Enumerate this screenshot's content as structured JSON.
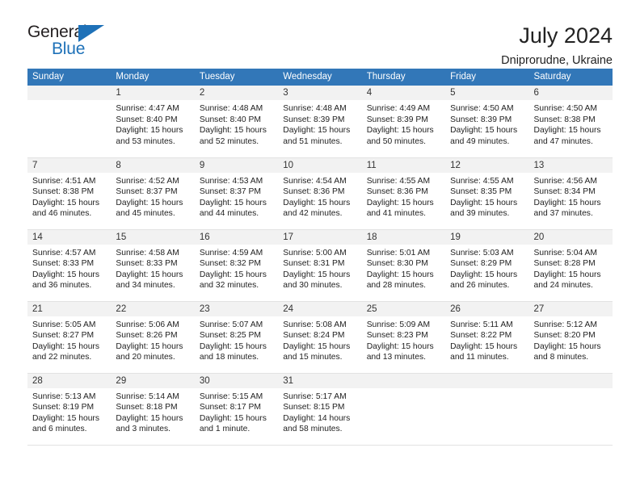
{
  "logo": {
    "text_general": "General",
    "text_blue": "Blue",
    "triangle_color": "#1e71b8"
  },
  "header": {
    "month_title": "July 2024",
    "location": "Dniprorudne, Ukraine"
  },
  "theme": {
    "header_bg": "#3277b8",
    "daynum_band_bg": "#f2f2f2",
    "grid_line": "#e2e2e2"
  },
  "calendar": {
    "weekday_headers": [
      "Sunday",
      "Monday",
      "Tuesday",
      "Wednesday",
      "Thursday",
      "Friday",
      "Saturday"
    ],
    "weeks": [
      [
        {
          "day": "",
          "sunrise": "",
          "sunset": "",
          "daylight_line1": "",
          "daylight_line2": ""
        },
        {
          "day": "1",
          "sunrise": "Sunrise: 4:47 AM",
          "sunset": "Sunset: 8:40 PM",
          "daylight_line1": "Daylight: 15 hours",
          "daylight_line2": "and 53 minutes."
        },
        {
          "day": "2",
          "sunrise": "Sunrise: 4:48 AM",
          "sunset": "Sunset: 8:40 PM",
          "daylight_line1": "Daylight: 15 hours",
          "daylight_line2": "and 52 minutes."
        },
        {
          "day": "3",
          "sunrise": "Sunrise: 4:48 AM",
          "sunset": "Sunset: 8:39 PM",
          "daylight_line1": "Daylight: 15 hours",
          "daylight_line2": "and 51 minutes."
        },
        {
          "day": "4",
          "sunrise": "Sunrise: 4:49 AM",
          "sunset": "Sunset: 8:39 PM",
          "daylight_line1": "Daylight: 15 hours",
          "daylight_line2": "and 50 minutes."
        },
        {
          "day": "5",
          "sunrise": "Sunrise: 4:50 AM",
          "sunset": "Sunset: 8:39 PM",
          "daylight_line1": "Daylight: 15 hours",
          "daylight_line2": "and 49 minutes."
        },
        {
          "day": "6",
          "sunrise": "Sunrise: 4:50 AM",
          "sunset": "Sunset: 8:38 PM",
          "daylight_line1": "Daylight: 15 hours",
          "daylight_line2": "and 47 minutes."
        }
      ],
      [
        {
          "day": "7",
          "sunrise": "Sunrise: 4:51 AM",
          "sunset": "Sunset: 8:38 PM",
          "daylight_line1": "Daylight: 15 hours",
          "daylight_line2": "and 46 minutes."
        },
        {
          "day": "8",
          "sunrise": "Sunrise: 4:52 AM",
          "sunset": "Sunset: 8:37 PM",
          "daylight_line1": "Daylight: 15 hours",
          "daylight_line2": "and 45 minutes."
        },
        {
          "day": "9",
          "sunrise": "Sunrise: 4:53 AM",
          "sunset": "Sunset: 8:37 PM",
          "daylight_line1": "Daylight: 15 hours",
          "daylight_line2": "and 44 minutes."
        },
        {
          "day": "10",
          "sunrise": "Sunrise: 4:54 AM",
          "sunset": "Sunset: 8:36 PM",
          "daylight_line1": "Daylight: 15 hours",
          "daylight_line2": "and 42 minutes."
        },
        {
          "day": "11",
          "sunrise": "Sunrise: 4:55 AM",
          "sunset": "Sunset: 8:36 PM",
          "daylight_line1": "Daylight: 15 hours",
          "daylight_line2": "and 41 minutes."
        },
        {
          "day": "12",
          "sunrise": "Sunrise: 4:55 AM",
          "sunset": "Sunset: 8:35 PM",
          "daylight_line1": "Daylight: 15 hours",
          "daylight_line2": "and 39 minutes."
        },
        {
          "day": "13",
          "sunrise": "Sunrise: 4:56 AM",
          "sunset": "Sunset: 8:34 PM",
          "daylight_line1": "Daylight: 15 hours",
          "daylight_line2": "and 37 minutes."
        }
      ],
      [
        {
          "day": "14",
          "sunrise": "Sunrise: 4:57 AM",
          "sunset": "Sunset: 8:33 PM",
          "daylight_line1": "Daylight: 15 hours",
          "daylight_line2": "and 36 minutes."
        },
        {
          "day": "15",
          "sunrise": "Sunrise: 4:58 AM",
          "sunset": "Sunset: 8:33 PM",
          "daylight_line1": "Daylight: 15 hours",
          "daylight_line2": "and 34 minutes."
        },
        {
          "day": "16",
          "sunrise": "Sunrise: 4:59 AM",
          "sunset": "Sunset: 8:32 PM",
          "daylight_line1": "Daylight: 15 hours",
          "daylight_line2": "and 32 minutes."
        },
        {
          "day": "17",
          "sunrise": "Sunrise: 5:00 AM",
          "sunset": "Sunset: 8:31 PM",
          "daylight_line1": "Daylight: 15 hours",
          "daylight_line2": "and 30 minutes."
        },
        {
          "day": "18",
          "sunrise": "Sunrise: 5:01 AM",
          "sunset": "Sunset: 8:30 PM",
          "daylight_line1": "Daylight: 15 hours",
          "daylight_line2": "and 28 minutes."
        },
        {
          "day": "19",
          "sunrise": "Sunrise: 5:03 AM",
          "sunset": "Sunset: 8:29 PM",
          "daylight_line1": "Daylight: 15 hours",
          "daylight_line2": "and 26 minutes."
        },
        {
          "day": "20",
          "sunrise": "Sunrise: 5:04 AM",
          "sunset": "Sunset: 8:28 PM",
          "daylight_line1": "Daylight: 15 hours",
          "daylight_line2": "and 24 minutes."
        }
      ],
      [
        {
          "day": "21",
          "sunrise": "Sunrise: 5:05 AM",
          "sunset": "Sunset: 8:27 PM",
          "daylight_line1": "Daylight: 15 hours",
          "daylight_line2": "and 22 minutes."
        },
        {
          "day": "22",
          "sunrise": "Sunrise: 5:06 AM",
          "sunset": "Sunset: 8:26 PM",
          "daylight_line1": "Daylight: 15 hours",
          "daylight_line2": "and 20 minutes."
        },
        {
          "day": "23",
          "sunrise": "Sunrise: 5:07 AM",
          "sunset": "Sunset: 8:25 PM",
          "daylight_line1": "Daylight: 15 hours",
          "daylight_line2": "and 18 minutes."
        },
        {
          "day": "24",
          "sunrise": "Sunrise: 5:08 AM",
          "sunset": "Sunset: 8:24 PM",
          "daylight_line1": "Daylight: 15 hours",
          "daylight_line2": "and 15 minutes."
        },
        {
          "day": "25",
          "sunrise": "Sunrise: 5:09 AM",
          "sunset": "Sunset: 8:23 PM",
          "daylight_line1": "Daylight: 15 hours",
          "daylight_line2": "and 13 minutes."
        },
        {
          "day": "26",
          "sunrise": "Sunrise: 5:11 AM",
          "sunset": "Sunset: 8:22 PM",
          "daylight_line1": "Daylight: 15 hours",
          "daylight_line2": "and 11 minutes."
        },
        {
          "day": "27",
          "sunrise": "Sunrise: 5:12 AM",
          "sunset": "Sunset: 8:20 PM",
          "daylight_line1": "Daylight: 15 hours",
          "daylight_line2": "and 8 minutes."
        }
      ],
      [
        {
          "day": "28",
          "sunrise": "Sunrise: 5:13 AM",
          "sunset": "Sunset: 8:19 PM",
          "daylight_line1": "Daylight: 15 hours",
          "daylight_line2": "and 6 minutes."
        },
        {
          "day": "29",
          "sunrise": "Sunrise: 5:14 AM",
          "sunset": "Sunset: 8:18 PM",
          "daylight_line1": "Daylight: 15 hours",
          "daylight_line2": "and 3 minutes."
        },
        {
          "day": "30",
          "sunrise": "Sunrise: 5:15 AM",
          "sunset": "Sunset: 8:17 PM",
          "daylight_line1": "Daylight: 15 hours",
          "daylight_line2": "and 1 minute."
        },
        {
          "day": "31",
          "sunrise": "Sunrise: 5:17 AM",
          "sunset": "Sunset: 8:15 PM",
          "daylight_line1": "Daylight: 14 hours",
          "daylight_line2": "and 58 minutes."
        },
        {
          "day": "",
          "sunrise": "",
          "sunset": "",
          "daylight_line1": "",
          "daylight_line2": ""
        },
        {
          "day": "",
          "sunrise": "",
          "sunset": "",
          "daylight_line1": "",
          "daylight_line2": ""
        },
        {
          "day": "",
          "sunrise": "",
          "sunset": "",
          "daylight_line1": "",
          "daylight_line2": ""
        }
      ]
    ]
  }
}
